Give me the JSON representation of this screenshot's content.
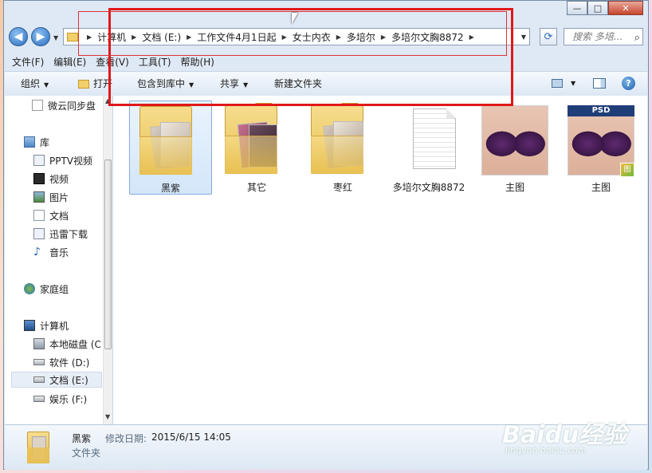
{
  "window": {
    "caption_buttons": {
      "minimize": "—",
      "maximize": "□",
      "close": "✕"
    }
  },
  "nav": {
    "back_icon": "back-arrow-icon",
    "forward_icon": "forward-arrow-icon",
    "breadcrumb": [
      "计算机",
      "文档 (E:)",
      "工作文件4月1日起",
      "女士内衣",
      "多培尔",
      "多培尔文胸8872"
    ],
    "search_placeholder": "搜索 多培..."
  },
  "menu": [
    "文件(F)",
    "编辑(E)",
    "查看(V)",
    "工具(T)",
    "帮助(H)"
  ],
  "toolbar": {
    "organize": "组织",
    "open": "打开",
    "include_in_library": "包含到库中",
    "share": "共享",
    "new_folder": "新建文件夹"
  },
  "sidebar": {
    "items": [
      {
        "label": "微云同步盘",
        "icon": "document-icon"
      },
      {
        "label": "库",
        "icon": "library-icon"
      },
      {
        "label": "PPTV视频",
        "icon": "library-item-icon"
      },
      {
        "label": "视频",
        "icon": "video-library-icon"
      },
      {
        "label": "图片",
        "icon": "picture-library-icon"
      },
      {
        "label": "文档",
        "icon": "document-library-icon"
      },
      {
        "label": "迅雷下载",
        "icon": "library-item-icon"
      },
      {
        "label": "音乐",
        "icon": "music-library-icon"
      },
      {
        "label": "家庭组",
        "icon": "homegroup-icon"
      },
      {
        "label": "计算机",
        "icon": "computer-icon"
      },
      {
        "label": "本地磁盘 (C",
        "icon": "system-drive-icon"
      },
      {
        "label": "软件 (D:)",
        "icon": "drive-icon"
      },
      {
        "label": "文档 (E:)",
        "icon": "drive-icon",
        "selected": true
      },
      {
        "label": "娱乐 (F:)",
        "icon": "drive-icon"
      }
    ]
  },
  "files": [
    {
      "name": "黑紫",
      "type": "folder",
      "selected": true
    },
    {
      "name": "其它",
      "type": "folder"
    },
    {
      "name": "枣红",
      "type": "folder"
    },
    {
      "name": "多培尔文胸8872",
      "type": "text-file"
    },
    {
      "name": "主图",
      "type": "image"
    },
    {
      "name": "主图",
      "type": "psd-image",
      "badge": "PSD"
    }
  ],
  "details": {
    "name": "黑紫",
    "date_label": "修改日期:",
    "date": "2015/6/15 14:05",
    "type": "文件夹"
  },
  "watermark": {
    "main": "Baidu经验",
    "sub": "jingyan.baidu.com"
  },
  "colors": {
    "annotation_red": "#e01818",
    "selection_blue": "#84acdd",
    "folder_yellow": "#e7bf50"
  }
}
